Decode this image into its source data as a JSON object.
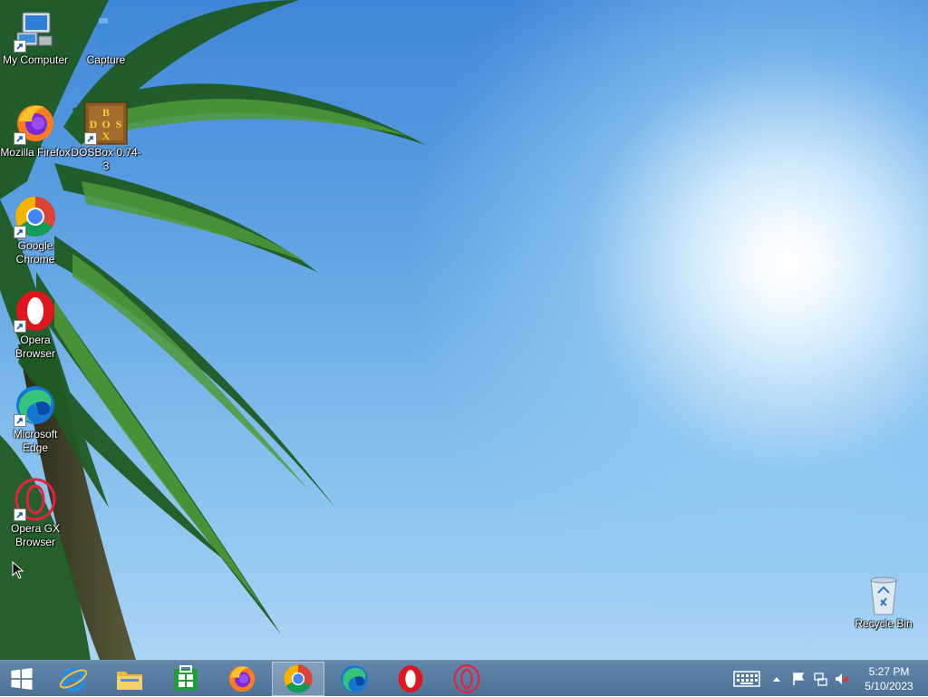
{
  "desktop": {
    "icons": [
      {
        "label": "My Computer",
        "icon": "computer-icon"
      },
      {
        "label": "Capture",
        "icon": "folder-icon"
      },
      {
        "label": "Mozilla Firefox",
        "icon": "firefox-icon"
      },
      {
        "label": "DOSBox 0.74-3",
        "icon": "dosbox-icon"
      },
      {
        "label": "Google Chrome",
        "icon": "chrome-icon"
      },
      {
        "label": "Opera Browser",
        "icon": "opera-icon"
      },
      {
        "label": "Microsoft Edge",
        "icon": "edge-icon"
      },
      {
        "label": "Opera GX Browser",
        "icon": "opera-gx-icon"
      },
      {
        "label": "Recycle Bin",
        "icon": "recycle-bin-icon"
      }
    ]
  },
  "taskbar": {
    "start": {
      "icon": "windows-logo-icon"
    },
    "pinned": [
      {
        "icon": "internet-explorer-icon"
      },
      {
        "icon": "file-explorer-icon"
      },
      {
        "icon": "store-icon"
      },
      {
        "icon": "firefox-icon"
      },
      {
        "icon": "chrome-icon",
        "active": true
      },
      {
        "icon": "edge-icon"
      },
      {
        "icon": "opera-icon"
      },
      {
        "icon": "opera-gx-icon"
      }
    ],
    "tray": {
      "icons": [
        "keyboard-icon",
        "chevron-up-icon",
        "flag-icon",
        "network-icon",
        "volume-muted-icon"
      ],
      "time": "5:27 PM",
      "date": "5/10/2023"
    }
  },
  "colors": {
    "sky_top": "#3f86d8",
    "sky_bottom": "#a9d5f5",
    "taskbar": "#5a7fa6"
  }
}
